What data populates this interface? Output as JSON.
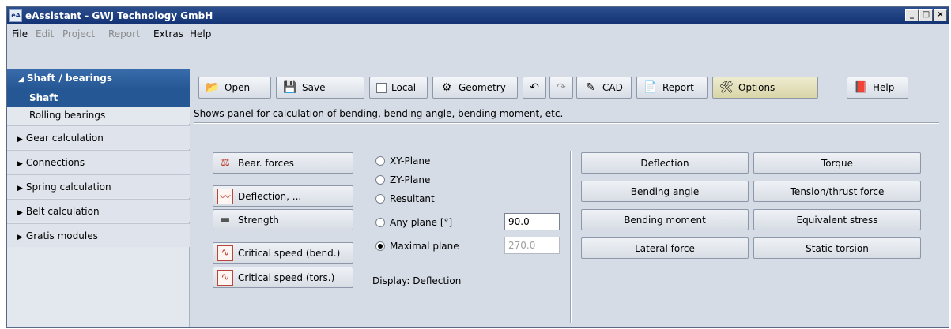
{
  "window": {
    "title": "eAssistant - GWJ Technology GmbH",
    "controls": [
      "_",
      "□",
      "×"
    ]
  },
  "menu": [
    {
      "label": "File",
      "enabled": true
    },
    {
      "label": "Edit",
      "enabled": false
    },
    {
      "label": "Project",
      "enabled": false
    },
    {
      "label": "Report",
      "enabled": false
    },
    {
      "label": "Extras",
      "enabled": true
    },
    {
      "label": "Help",
      "enabled": true
    }
  ],
  "sidebar": {
    "header": "Shaft / bearings",
    "items": [
      {
        "label": "Shaft",
        "active": true
      },
      {
        "label": "Rolling bearings",
        "active": false
      }
    ],
    "groups": [
      "Gear calculation",
      "Connections",
      "Spring calculation",
      "Belt calculation",
      "Gratis modules"
    ]
  },
  "toolbar": {
    "open": "Open",
    "save": "Save",
    "local": "Local",
    "geometry": "Geometry",
    "cad": "CAD",
    "report": "Report",
    "options": "Options",
    "help": "Help"
  },
  "status": "Shows panel for calculation of bending, bending angle, bending moment, etc.",
  "actions": {
    "bear_forces": "Bear. forces",
    "deflection": "Deflection, ...",
    "strength": "Strength",
    "critical_bend": "Critical speed (bend.)",
    "critical_tors": "Critical speed (tors.)"
  },
  "planes": {
    "xy": "XY-Plane",
    "zy": "ZY-Plane",
    "resultant": "Resultant",
    "any": "Any plane [°]",
    "maximal": "Maximal plane",
    "selected": "maximal",
    "any_value": "90.0",
    "maximal_value": "270.0"
  },
  "display": {
    "label": "Display:",
    "value": "Deflection"
  },
  "results": {
    "left": [
      "Deflection",
      "Bending angle",
      "Bending moment",
      "Lateral force"
    ],
    "right": [
      "Torque",
      "Tension/thrust force",
      "Equivalent stress",
      "Static torsion"
    ]
  },
  "colors": {
    "title_bar": "#123273",
    "sidebar_active": "#245794",
    "panel_bg": "#d6dce6"
  }
}
